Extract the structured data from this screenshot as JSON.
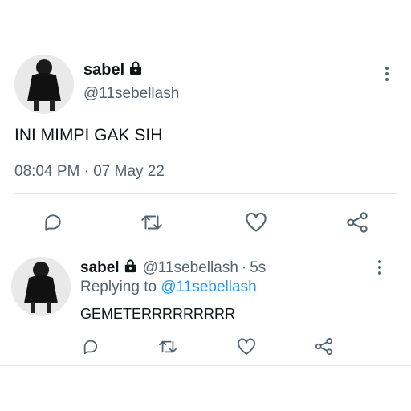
{
  "main_tweet": {
    "display_name": "sabel",
    "handle": "@11sebellash",
    "text": "INI MIMPI GAK SIH",
    "timestamp": "08:04 PM · 07 May 22",
    "actions": [
      "reply-icon",
      "retweet-icon",
      "like-icon",
      "share-icon"
    ]
  },
  "reply_tweet": {
    "display_name": "sabel",
    "handle": "@11sebellash",
    "time_sep": "·",
    "time": "5s",
    "replying_prefix": "Replying to",
    "replying_handle": "@11sebellash",
    "text": "GEMETERRRRRRRRR",
    "actions": [
      "reply-icon",
      "retweet-icon",
      "like-icon",
      "share-icon"
    ]
  },
  "colors": {
    "text": "#0f1419",
    "secondary": "#536471",
    "link": "#1d9bf0",
    "divider": "#e6e6e6"
  }
}
